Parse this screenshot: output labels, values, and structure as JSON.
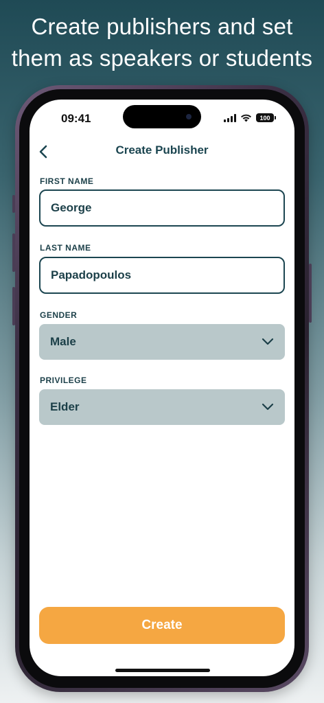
{
  "headline": {
    "line1": "Create publishers and set",
    "line2": "them as speakers or students"
  },
  "status_bar": {
    "time": "09:41",
    "battery": "100"
  },
  "nav": {
    "back_icon": "chevron-left-icon",
    "title": "Create Publisher"
  },
  "form": {
    "first_name": {
      "label": "FIRST NAME",
      "value": "George"
    },
    "last_name": {
      "label": "LAST NAME",
      "value": "Papadopoulos"
    },
    "gender": {
      "label": "GENDER",
      "selected": "Male"
    },
    "privilege": {
      "label": "PRIVILEGE",
      "selected": "Elder"
    }
  },
  "actions": {
    "create_label": "Create"
  },
  "colors": {
    "accent": "#F5A742",
    "primary": "#1B4550",
    "select_bg": "#B9C8CA"
  }
}
